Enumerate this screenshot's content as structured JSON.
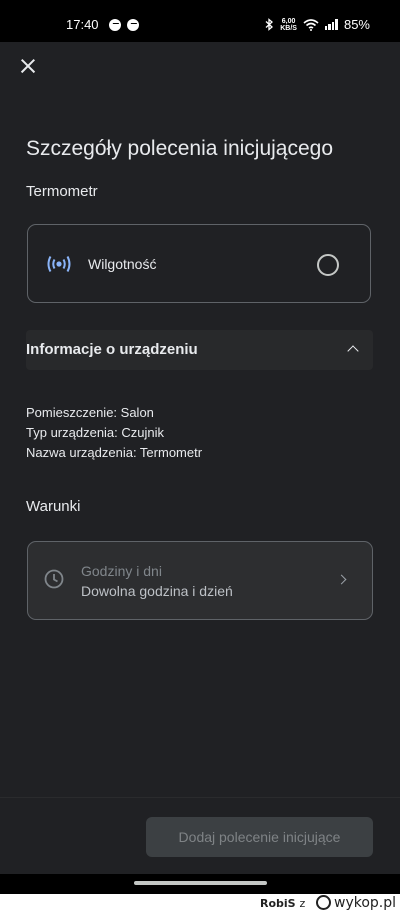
{
  "status_bar": {
    "time": "17:40",
    "net_speed_value": "6,00",
    "net_speed_unit": "KB/S",
    "battery": "85%"
  },
  "header": {
    "title": "Szczegóły polecenia inicjującego",
    "device": "Termometr"
  },
  "trigger_option": {
    "label": "Wilgotność",
    "selected": false,
    "icon": "sensor-icon",
    "icon_color": "#8ab4f8"
  },
  "device_info": {
    "section_title": "Informacje o urządzeniu",
    "lines": [
      "Pomieszczenie: Salon",
      "Typ urządzenia: Czujnik",
      "Nazwa urządzenia: Termometr"
    ]
  },
  "conditions": {
    "title": "Warunki",
    "item": {
      "name": "Godziny i dni",
      "value": "Dowolna godzina i dzień",
      "icon": "clock-icon"
    }
  },
  "footer": {
    "add_button": "Dodaj polecenie inicjujące"
  },
  "watermark": {
    "user": "RobiS",
    "separator": "z",
    "site": "wykop.pl"
  }
}
